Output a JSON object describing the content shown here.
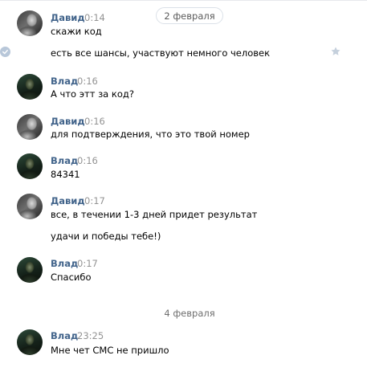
{
  "dates": {
    "first": "2 февраля",
    "second": "4 февраля"
  },
  "messages": [
    {
      "author": "Давид",
      "time": "0:14",
      "lines": [
        "скажи код",
        "есть все шансы, участвуют немного человек"
      ]
    },
    {
      "author": "Влад",
      "time": "0:16",
      "lines": [
        "А что этт за код?"
      ]
    },
    {
      "author": "Давид",
      "time": "0:16",
      "lines": [
        "для подтверждения, что это твой номер"
      ]
    },
    {
      "author": "Влад",
      "time": "0:16",
      "lines": [
        "84341"
      ]
    },
    {
      "author": "Давид",
      "time": "0:17",
      "lines": [
        "все, в течении 1-3 дней придет результат",
        "удачи и победы тебе!)"
      ]
    },
    {
      "author": "Влад",
      "time": "0:17",
      "lines": [
        "Спасибо"
      ]
    },
    {
      "author": "Влад",
      "time": "23:25",
      "lines": [
        "Мне чет СМС не пришло"
      ]
    }
  ],
  "icons": {
    "selected_check": "check-circle-icon",
    "favorite": "star-icon"
  },
  "colors": {
    "author": "#42648b",
    "time": "#939393",
    "check_bg": "#b8c7d9",
    "star": "#c5d0dc"
  }
}
